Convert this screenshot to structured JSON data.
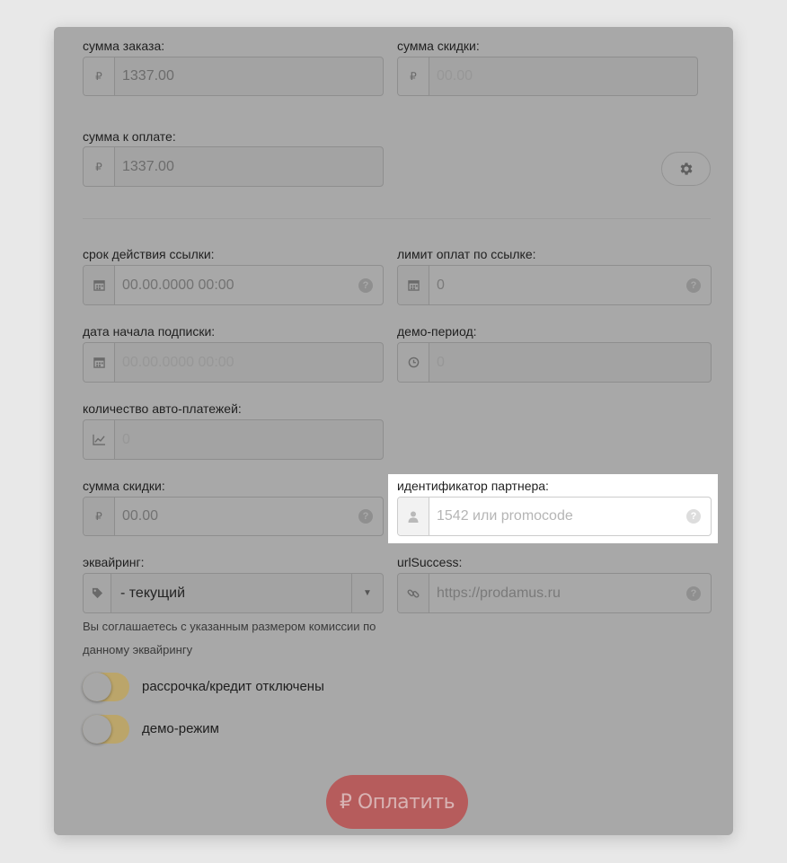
{
  "order_sum": {
    "label": "сумма заказа:",
    "currency_symbol": "₽",
    "value": "1337.00"
  },
  "discount_sum_top": {
    "label": "сумма скидки:",
    "currency_symbol": "₽",
    "placeholder": "00.00"
  },
  "pay_sum": {
    "label": "сумма к оплате:",
    "currency_symbol": "₽",
    "value": "1337.00"
  },
  "link_expiry": {
    "label": "срок действия ссылки:",
    "placeholder": "00.00.0000 00:00",
    "icon": "calendar-icon"
  },
  "payment_limit": {
    "label": "лимит оплат по ссылке:",
    "placeholder": "0",
    "icon": "calendar-icon"
  },
  "subscription_start": {
    "label": "дата начала подписки:",
    "placeholder": "00.00.0000 00:00",
    "icon": "calendar-icon"
  },
  "demo_period": {
    "label": "демо-период:",
    "placeholder": "0",
    "icon": "clock-icon"
  },
  "auto_payments": {
    "label": "количество авто-платежей:",
    "placeholder": "0",
    "icon": "chart-icon"
  },
  "discount_sum": {
    "label": "сумма скидки:",
    "currency_symbol": "₽",
    "placeholder": "00.00"
  },
  "partner_id": {
    "label": "идентификатор партнера:",
    "placeholder": "1542 или promocode",
    "icon": "user-icon"
  },
  "acquiring": {
    "label": "эквайринг:",
    "selected": "- текущий",
    "note": "Вы соглашаетесь с указанным размером комиссии по данному эквайрингу",
    "icon": "tag-icon"
  },
  "url_success": {
    "label": "urlSuccess:",
    "placeholder": "https://prodamus.ru",
    "icon": "link-icon"
  },
  "toggles": [
    {
      "label": "рассрочка/кредит отключены",
      "on": false
    },
    {
      "label": "демо-режим",
      "on": false
    }
  ],
  "pay_button": {
    "label": "₽ Оплатить"
  },
  "help_mark": "?",
  "colors": {
    "overlay_card": "#a8a8a8",
    "toggle_track": "#bba56a",
    "pay_button": "#b65c5c",
    "highlight": "#ffffff"
  }
}
